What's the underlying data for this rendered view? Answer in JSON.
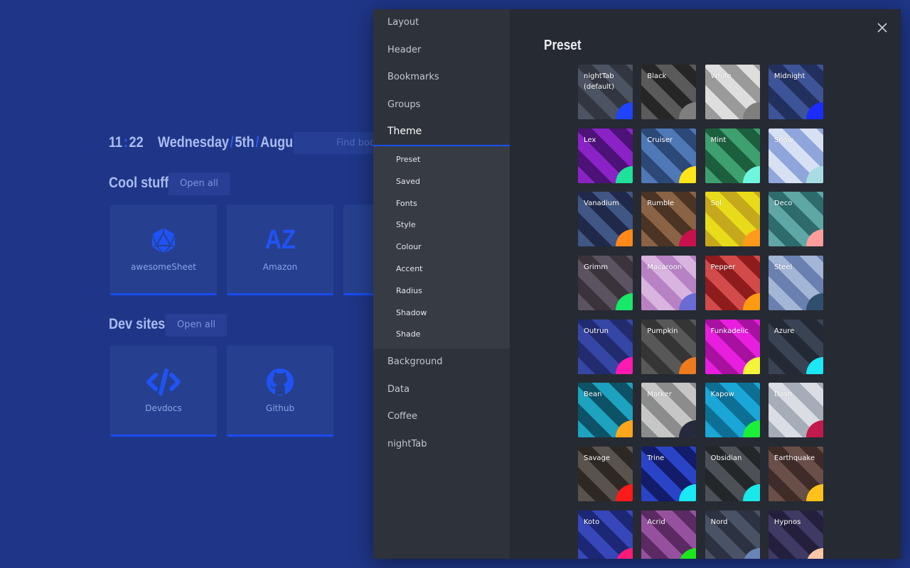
{
  "clock": {
    "hours": "11",
    "separator": ":",
    "minutes": "22"
  },
  "date": {
    "day": "Wednesday",
    "sep": "/",
    "num": "5th",
    "month": "August"
  },
  "search": {
    "placeholder": "Find boo"
  },
  "groups": [
    {
      "title": "Cool stuff",
      "open_all": "Open all",
      "bookmarks": [
        {
          "label": "awesomeSheet",
          "icon": "d20-icon"
        },
        {
          "label": "Amazon",
          "icon": "AZ"
        }
      ]
    },
    {
      "title": "Dev sites",
      "open_all": "Open all",
      "bookmarks": [
        {
          "label": "Devdocs",
          "icon": "code-icon"
        },
        {
          "label": "Github",
          "icon": "github-icon"
        }
      ]
    }
  ],
  "menu": {
    "top": [
      "Layout",
      "Header",
      "Bookmarks",
      "Groups"
    ],
    "active": "Theme",
    "sub": [
      "Preset",
      "Saved",
      "Fonts",
      "Style",
      "Colour",
      "Accent",
      "Radius",
      "Shadow",
      "Shade"
    ],
    "bottom": [
      "Background",
      "Data",
      "Coffee",
      "nightTab"
    ]
  },
  "panel_title": "Preset",
  "presets": [
    {
      "name": "nightTab (default)",
      "c1": "#4c5362",
      "c2": "#313640",
      "accent": "#1f44ff"
    },
    {
      "name": "Black",
      "c1": "#5a5a5a",
      "c2": "#262626",
      "accent": "#7e7e7e"
    },
    {
      "name": "White",
      "c1": "#9a9a9a",
      "c2": "#dedede",
      "accent": "#7e7e7e"
    },
    {
      "name": "Midnight",
      "c1": "#3e5498",
      "c2": "#22305e",
      "accent": "#1a2cff"
    },
    {
      "name": "Lex",
      "c1": "#8b22c6",
      "c2": "#4c1277",
      "accent": "#1ee29a"
    },
    {
      "name": "Cruiser",
      "c1": "#4f78b6",
      "c2": "#2c4877",
      "accent": "#ffe61a"
    },
    {
      "name": "Mint",
      "c1": "#3fa06f",
      "c2": "#1c5f3e",
      "accent": "#6ef7de"
    },
    {
      "name": "Snow",
      "c1": "#8fa6dc",
      "c2": "#d8e0f3",
      "accent": "#a8dce4"
    },
    {
      "name": "Vanadium",
      "c1": "#405684",
      "c2": "#20294a",
      "accent": "#ff8a1a"
    },
    {
      "name": "Rumble",
      "c1": "#8a6244",
      "c2": "#4b3424",
      "accent": "#c8114c"
    },
    {
      "name": "Sol",
      "c1": "#c6a81c",
      "c2": "#e8dc1a",
      "accent": "#ff9a1a"
    },
    {
      "name": "Deco",
      "c1": "#5fa7a6",
      "c2": "#2d6b6c",
      "accent": "#ff9c9c"
    },
    {
      "name": "Grimm",
      "c1": "#5b5360",
      "c2": "#3a333c",
      "accent": "#18e86a"
    },
    {
      "name": "Macaroon",
      "c1": "#b782c4",
      "c2": "#d8b4df",
      "accent": "#6b6bd6"
    },
    {
      "name": "Pepper",
      "c1": "#d24a4a",
      "c2": "#8e1c1c",
      "accent": "#ff9a12"
    },
    {
      "name": "Steel",
      "c1": "#6a80b0",
      "c2": "#a4b6d6",
      "accent": "#2e4f6d"
    },
    {
      "name": "Outrun",
      "c1": "#3646a6",
      "c2": "#212b6e",
      "accent": "#ff1ab0"
    },
    {
      "name": "Pumpkin",
      "c1": "#585858",
      "c2": "#353535",
      "accent": "#f07a1e"
    },
    {
      "name": "Funkadelic",
      "c1": "#e81edf",
      "c2": "#a8109f",
      "accent": "#f4f43a"
    },
    {
      "name": "Azure",
      "c1": "#3a4354",
      "c2": "#232935",
      "accent": "#1ae8f4"
    },
    {
      "name": "Bean",
      "c1": "#1da2bf",
      "c2": "#0d5266",
      "accent": "#ffa61a"
    },
    {
      "name": "Marker",
      "c1": "#8c8c8c",
      "c2": "#c6c6c6",
      "accent": "#262a3e"
    },
    {
      "name": "Kapow",
      "c1": "#1aa6d6",
      "c2": "#0e6f95",
      "accent": "#1af03a"
    },
    {
      "name": "Dash",
      "c1": "#a6acb8",
      "c2": "#dadde3",
      "accent": "#c21a4a"
    },
    {
      "name": "Savage",
      "c1": "#5a524c",
      "c2": "#2e2825",
      "accent": "#ff1a1a"
    },
    {
      "name": "Trine",
      "c1": "#2a44c8",
      "c2": "#121c6a",
      "accent": "#1ae8f4"
    },
    {
      "name": "Obsidian",
      "c1": "#4b5157",
      "c2": "#23272a",
      "accent": "#1ae8e8"
    },
    {
      "name": "Earthquake",
      "c1": "#6a4e48",
      "c2": "#3f2c28",
      "accent": "#ffc21a"
    },
    {
      "name": "Koto",
      "c1": "#3746b8",
      "c2": "#1c2776",
      "accent": "#ff1a7a"
    },
    {
      "name": "Acrid",
      "c1": "#95519e",
      "c2": "#5b2a63",
      "accent": "#1ae81a"
    },
    {
      "name": "Nord",
      "c1": "#4a5266",
      "c2": "#2d3242",
      "accent": "#6a86b8"
    },
    {
      "name": "Hypnos",
      "c1": "#3f3a63",
      "c2": "#241f3d",
      "accent": "#ffc6a6"
    }
  ]
}
